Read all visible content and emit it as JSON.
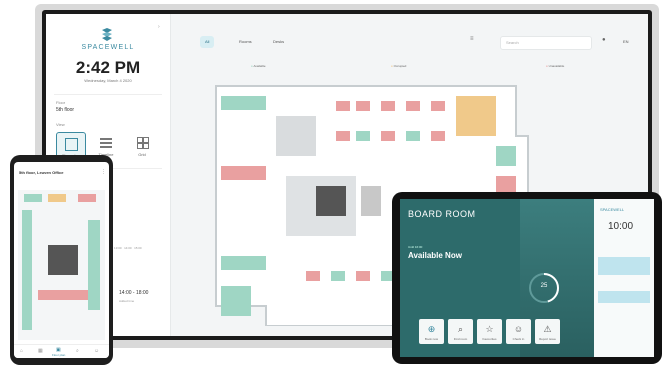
{
  "monitor": {
    "brand": "SPACEWELL",
    "time": "2:42 PM",
    "date": "Wednesday, March 4 2020",
    "location_label": "Floor",
    "location_value": "5th floor",
    "views_label": "View",
    "views": [
      "Floor plan",
      "Timeline",
      "Grid"
    ],
    "filter_all": "All",
    "filter_rooms": "Rooms",
    "filter_desks": "Desks",
    "search_placeholder": "Search",
    "lang": "EN",
    "legend": [
      "Available",
      "Occupied",
      "Unavailable"
    ],
    "time_range": "14:00 - 18:00",
    "time_caption": "Added time",
    "timeline_ticks": [
      "12:00",
      "13:00",
      "14:00",
      "15:00"
    ]
  },
  "phone": {
    "title": "5th floor, Leuven Office",
    "nav": [
      "",
      "",
      "Floor plan",
      "",
      ""
    ]
  },
  "tablet": {
    "room": "BOARD ROOM",
    "status": "Available Now",
    "status_small": "Until 16:00",
    "clock": "10:00",
    "countdown": "25",
    "brand": "SPACEWELL",
    "actions": [
      "Book now",
      "Find room",
      "Favourites",
      "Check in",
      "Report issue"
    ]
  },
  "colors": {
    "accent": "#3b8aa0",
    "available": "#9fd6c4",
    "occupied": "#e9a0a0",
    "pending": "#f0c98a",
    "tablet_bg": "#2d6b6b"
  }
}
